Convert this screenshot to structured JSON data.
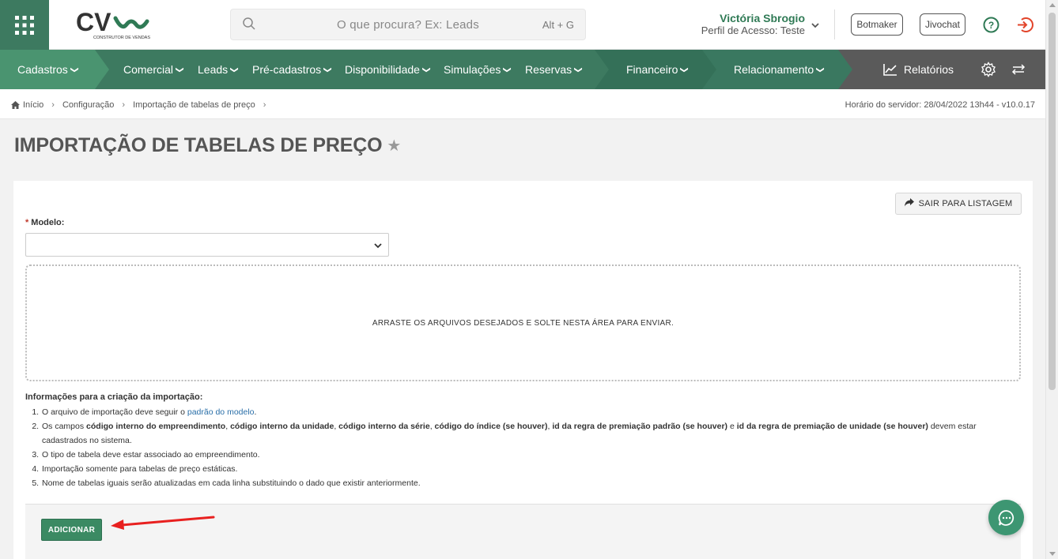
{
  "header": {
    "menu_icon": "grid-menu-icon",
    "logo_text": "CV",
    "logo_tagline": "CONSTRUTOR DE VENDAS",
    "search": {
      "placeholder": "O que procura? Ex: Leads",
      "shortcut": "Alt + G"
    },
    "user": {
      "name": "Victória Sbrogio",
      "profile": "Perfil de Acesso: Teste"
    },
    "botmaker_label": "Botmaker",
    "jivochat_label": "Jivochat"
  },
  "nav": {
    "items": [
      {
        "label": "Cadastros"
      },
      {
        "label": "Comercial"
      },
      {
        "label": "Leads"
      },
      {
        "label": "Pré-cadastros"
      },
      {
        "label": "Disponibilidade"
      },
      {
        "label": "Simulações"
      },
      {
        "label": "Reservas"
      },
      {
        "label": "Financeiro"
      },
      {
        "label": "Relacionamento"
      }
    ],
    "reports_label": "Relatórios"
  },
  "breadcrumb": {
    "items": [
      "Início",
      "Configuração",
      "Importação de tabelas de preço"
    ],
    "server_time": "Horário do servidor: 28/04/2022 13h44 - v10.0.17"
  },
  "page": {
    "title": "IMPORTAÇÃO DE TABELAS DE PREÇO",
    "exit_label": "SAIR PARA LISTAGEM",
    "model_label": "Modelo:",
    "required_mark": "*",
    "model_value": "",
    "dropzone_text": "ARRASTE OS ARQUIVOS DESEJADOS E SOLTE NESTA ÁREA PARA ENVIAR.",
    "add_label": "ADICIONAR"
  },
  "info": {
    "title": "Informações para a criação da importação:",
    "item1_text": "O arquivo de importação deve seguir o ",
    "item1_link": "padrão do modelo",
    "item1_end": ".",
    "item2_parts": [
      "Os campos ",
      "código interno do empreendimento",
      ", ",
      "código interno da unidade",
      ", ",
      "código interno da série",
      ", ",
      "código do índice (se houver)",
      ", ",
      "id da regra de premiação padrão (se houver)",
      " e ",
      "id da regra de premiação de unidade (se houver)",
      " devem estar cadastrados no sistema."
    ],
    "item3": "O tipo de tabela deve estar associado ao empreendimento.",
    "item4": "Importação somente para tabelas de preço estáticas.",
    "item5": "Nome de tabelas iguais serão atualizadas em cada linha substituindo o dado que existir anteriormente."
  },
  "colors": {
    "brand_green": "#3d7a60",
    "nav_light": "#4a9470",
    "nav_dark": "#5a5a5a",
    "logout_red": "#e2442a",
    "arrow_red": "#e8201f",
    "add_button": "#3b8a63"
  }
}
